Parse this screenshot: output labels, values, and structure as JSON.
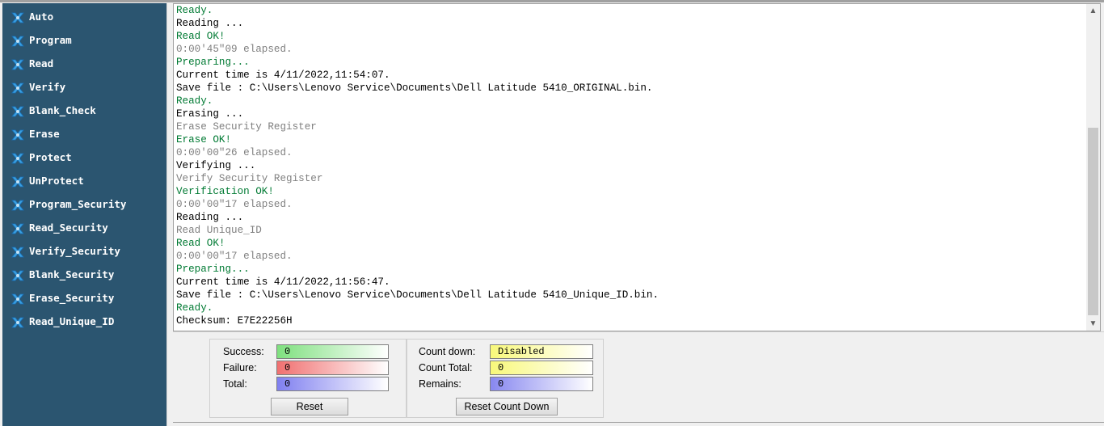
{
  "sidebar": {
    "items": [
      {
        "label": "Auto"
      },
      {
        "label": "Program"
      },
      {
        "label": "Read"
      },
      {
        "label": "Verify"
      },
      {
        "label": "Blank_Check"
      },
      {
        "label": "Erase"
      },
      {
        "label": "Protect"
      },
      {
        "label": "UnProtect"
      },
      {
        "label": "Program_Security"
      },
      {
        "label": "Read_Security"
      },
      {
        "label": "Verify_Security"
      },
      {
        "label": "Blank_Security"
      },
      {
        "label": "Erase_Security"
      },
      {
        "label": "Read_Unique_ID"
      }
    ],
    "icon": "blue-x-icon"
  },
  "log": {
    "lines": [
      {
        "text": "Ready.",
        "color": "green"
      },
      {
        "text": "Reading ...",
        "color": "black"
      },
      {
        "text": "Read OK!",
        "color": "green"
      },
      {
        "text": "0:00'45\"09 elapsed.",
        "color": "gray"
      },
      {
        "text": "Preparing...",
        "color": "green"
      },
      {
        "text": "Current time is 4/11/2022,11:54:07.",
        "color": "black"
      },
      {
        "text": "Save file : C:\\Users\\Lenovo Service\\Documents\\Dell Latitude 5410_ORIGINAL.bin.",
        "color": "black"
      },
      {
        "text": "Ready.",
        "color": "green"
      },
      {
        "text": "Erasing ...",
        "color": "black"
      },
      {
        "text": "Erase Security Register",
        "color": "gray"
      },
      {
        "text": "Erase OK!",
        "color": "green"
      },
      {
        "text": "0:00'00\"26 elapsed.",
        "color": "gray"
      },
      {
        "text": "Verifying ...",
        "color": "black"
      },
      {
        "text": "Verify Security Register",
        "color": "gray"
      },
      {
        "text": "Verification OK!",
        "color": "green"
      },
      {
        "text": "0:00'00\"17 elapsed.",
        "color": "gray"
      },
      {
        "text": "Reading ...",
        "color": "black"
      },
      {
        "text": "Read Unique_ID",
        "color": "gray"
      },
      {
        "text": "Read OK!",
        "color": "green"
      },
      {
        "text": "0:00'00\"17 elapsed.",
        "color": "gray"
      },
      {
        "text": "Preparing...",
        "color": "green"
      },
      {
        "text": "Current time is 4/11/2022,11:56:47.",
        "color": "black"
      },
      {
        "text": "Save file : C:\\Users\\Lenovo Service\\Documents\\Dell Latitude 5410_Unique_ID.bin.",
        "color": "black"
      },
      {
        "text": "Ready.",
        "color": "green"
      },
      {
        "text": "Checksum: E7E22256H",
        "color": "black"
      }
    ]
  },
  "stats": {
    "success_label": "Success:",
    "success_value": "0",
    "failure_label": "Failure:",
    "failure_value": "0",
    "total_label": "Total:",
    "total_value": "0",
    "reset_label": "Reset"
  },
  "countdown": {
    "countdown_label": "Count down:",
    "countdown_value": "Disabled",
    "count_total_label": "Count Total:",
    "count_total_value": "0",
    "remains_label": "Remains:",
    "remains_value": "0",
    "reset_label": "Reset Count Down"
  },
  "colors": {
    "sidebar_bg": "#2b5570",
    "log_green": "#007a33",
    "log_gray": "#808080",
    "icon_blue": "#3aa0e0"
  }
}
